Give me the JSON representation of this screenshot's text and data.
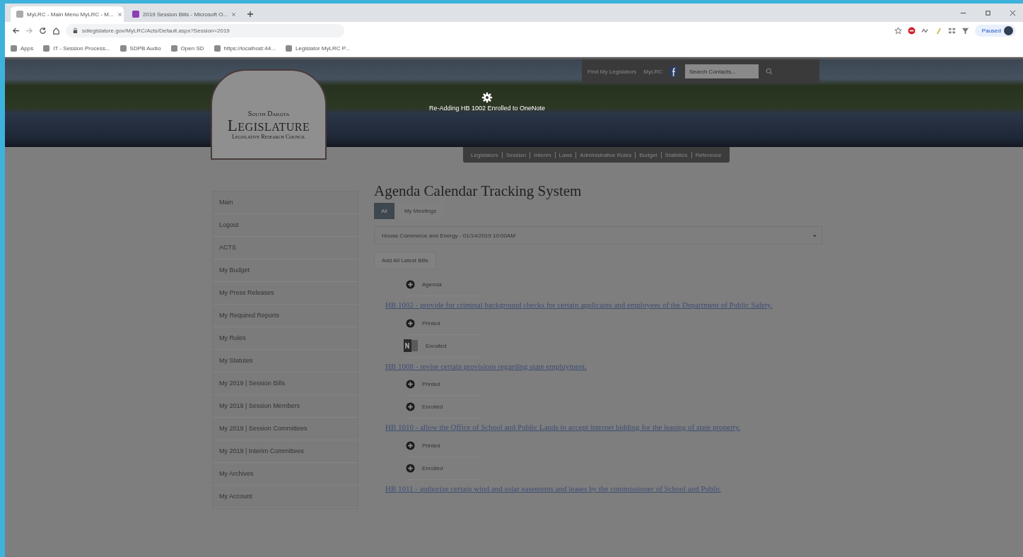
{
  "browser": {
    "tabs": [
      {
        "title": "MyLRC - Main Menu MyLRC - M...",
        "selected": true
      },
      {
        "title": "2019 Session Bills - Microsoft O...",
        "selected": false
      }
    ],
    "url": "sdlegislature.gov/MyLRC/Acts/Default.aspx?Session=2019",
    "bookmarks": [
      "Apps",
      "IT - Session Process...",
      "SDPB Audio",
      "Open SD",
      "https://localhost:44...",
      "Legislator MyLRC P..."
    ],
    "profile": "Paused"
  },
  "header": {
    "top_links": [
      "Find My Legislators",
      "MyLRC"
    ],
    "search": {
      "placeholder": "Search Contacts..."
    },
    "logo": {
      "line_1": "South Dakota",
      "line_2": "Legislature",
      "line_3": "Legislative Research Council"
    },
    "status": "Re-Adding HB 1002 Enrolled to OneNote",
    "nav": [
      "Legislators",
      "Session",
      "Interim",
      "Laws",
      "Administrative Rules",
      "Budget",
      "Statistics",
      "Reference"
    ]
  },
  "sidebar": {
    "items": [
      "Main",
      "Logout",
      "ACTS",
      "My Budget",
      "My Press Releases",
      "My Required Reports",
      "My Rules",
      "My Statutes",
      "My 2019 | Session Bills",
      "My 2019 | Session Members",
      "My 2019 | Session Committees",
      "My 2019 | Interim Committees",
      "My Archives",
      "My Account"
    ]
  },
  "main": {
    "title": "Agenda Calendar Tracking System",
    "tabs": [
      {
        "label": "All",
        "selected": true
      },
      {
        "label": "My Meetings",
        "selected": false
      }
    ],
    "meeting_select": {
      "value": "House Commerce and Energy - 01/14/2019 10:00AM"
    },
    "add_button": "Add All Latest Bills",
    "agenda": {
      "kind": "add",
      "label": "Agenda"
    },
    "bills": [
      {
        "title": "HB 1002 - provide for criminal background checks for certain applicants and employees of the Department of Public Safety.",
        "documents": [
          {
            "kind": "add",
            "label": "Printed"
          },
          {
            "kind": "onenote",
            "label": "Enrolled"
          }
        ]
      },
      {
        "title": "HB 1008 - revise certain provisions regarding state employment.",
        "documents": [
          {
            "kind": "add",
            "label": "Printed"
          },
          {
            "kind": "add",
            "label": "Enrolled"
          }
        ]
      },
      {
        "title": "HB 1010 - allow the Office of School and Public Lands to accept internet bidding for the leasing of state property.",
        "documents": [
          {
            "kind": "add",
            "label": "Printed"
          },
          {
            "kind": "add",
            "label": "Enrolled"
          }
        ]
      },
      {
        "title": "HB 1011 - authorize certain wind and solar easements and leases by the commissioner of School and Public"
      }
    ]
  }
}
